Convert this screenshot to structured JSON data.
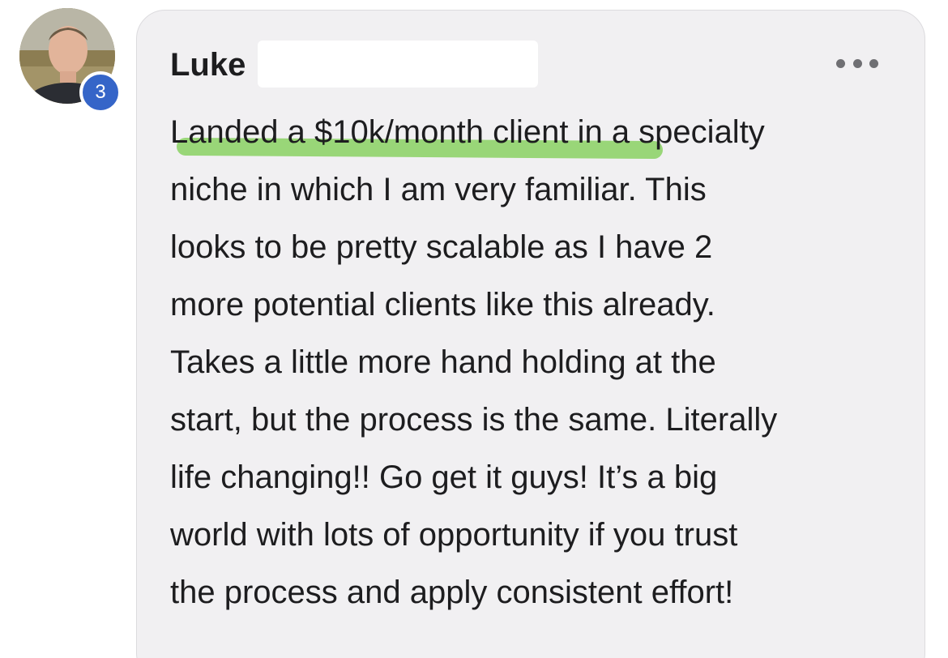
{
  "post": {
    "author": "Luke",
    "badge_count": "3",
    "lines": [
      "Landed a $10k/month client in a specialty",
      "niche in which I am very familiar. This",
      "looks to be pretty scalable as I have 2",
      "more potential clients like this already.",
      "Takes a little more hand holding at the",
      "start, but the process is the same. Literally",
      "life changing!! Go get it guys! It’s a big",
      "world with lots of opportunity if you trust",
      "the process and apply consistent effort!"
    ]
  },
  "icons": {
    "more": "more-horizontal-icon",
    "avatar": "profile-photo"
  },
  "colors": {
    "badge": "#3565c8",
    "bubble": "#f1f0f2",
    "highlight": "#8fd36a",
    "text": "#1d1d1f"
  }
}
